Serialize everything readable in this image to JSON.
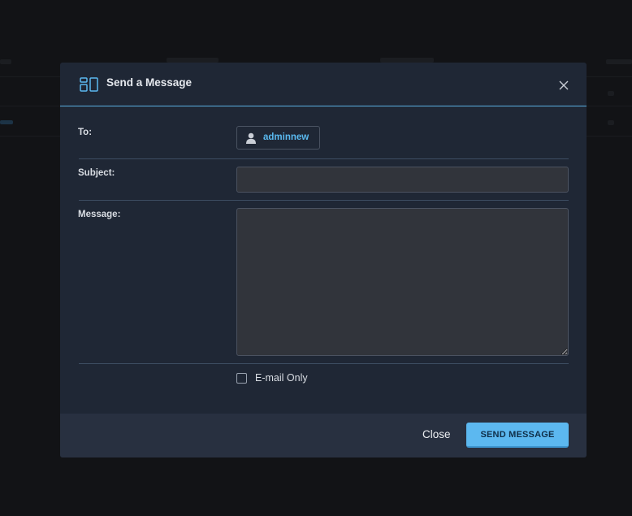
{
  "dialog": {
    "title": "Send a Message",
    "header_icon": "layout-icon",
    "close_icon": "close-icon"
  },
  "form": {
    "to_label": "To:",
    "recipient": "adminnew",
    "recipient_icon": "user-icon",
    "subject_label": "Subject:",
    "subject_value": "",
    "message_label": "Message:",
    "message_value": "",
    "email_only_label": "E-mail Only",
    "email_only_checked": false
  },
  "footer": {
    "close_label": "Close",
    "send_label": "SEND MESSAGE"
  },
  "colors": {
    "modal_bg": "#1f2735",
    "accent": "#5cb8f0",
    "input_bg": "#31343b",
    "backdrop": "#121316"
  }
}
